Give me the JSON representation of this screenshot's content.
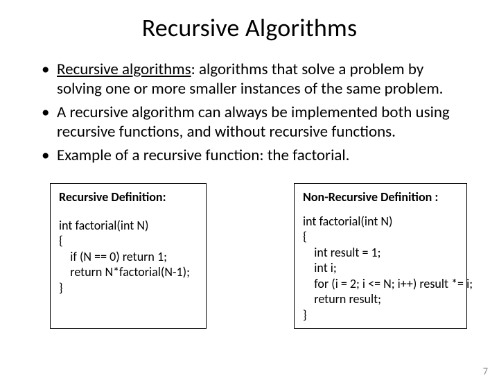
{
  "title": "Recursive Algorithms",
  "bullets": [
    {
      "term": "Recursive algorithms",
      "rest": ": algorithms that solve a problem by solving one or more smaller instances of the same problem."
    },
    {
      "text": "A recursive algorithm can always be implemented both using recursive functions, and without recursive functions."
    },
    {
      "text": "Example of a recursive function: the factorial."
    }
  ],
  "box_left": {
    "title": "Recursive  Definition:",
    "code": "int factorial(int N)\n{\n    if (N == 0) return 1;\n    return N*factorial(N-1);\n}"
  },
  "box_right": {
    "title": "Non-Recursive Definition :",
    "code": "int factorial(int N)\n{\n    int result = 1;\n    int i;\n    for (i = 2; i <= N; i++) result *= i;\n    return result;\n}"
  },
  "page_number": "7"
}
